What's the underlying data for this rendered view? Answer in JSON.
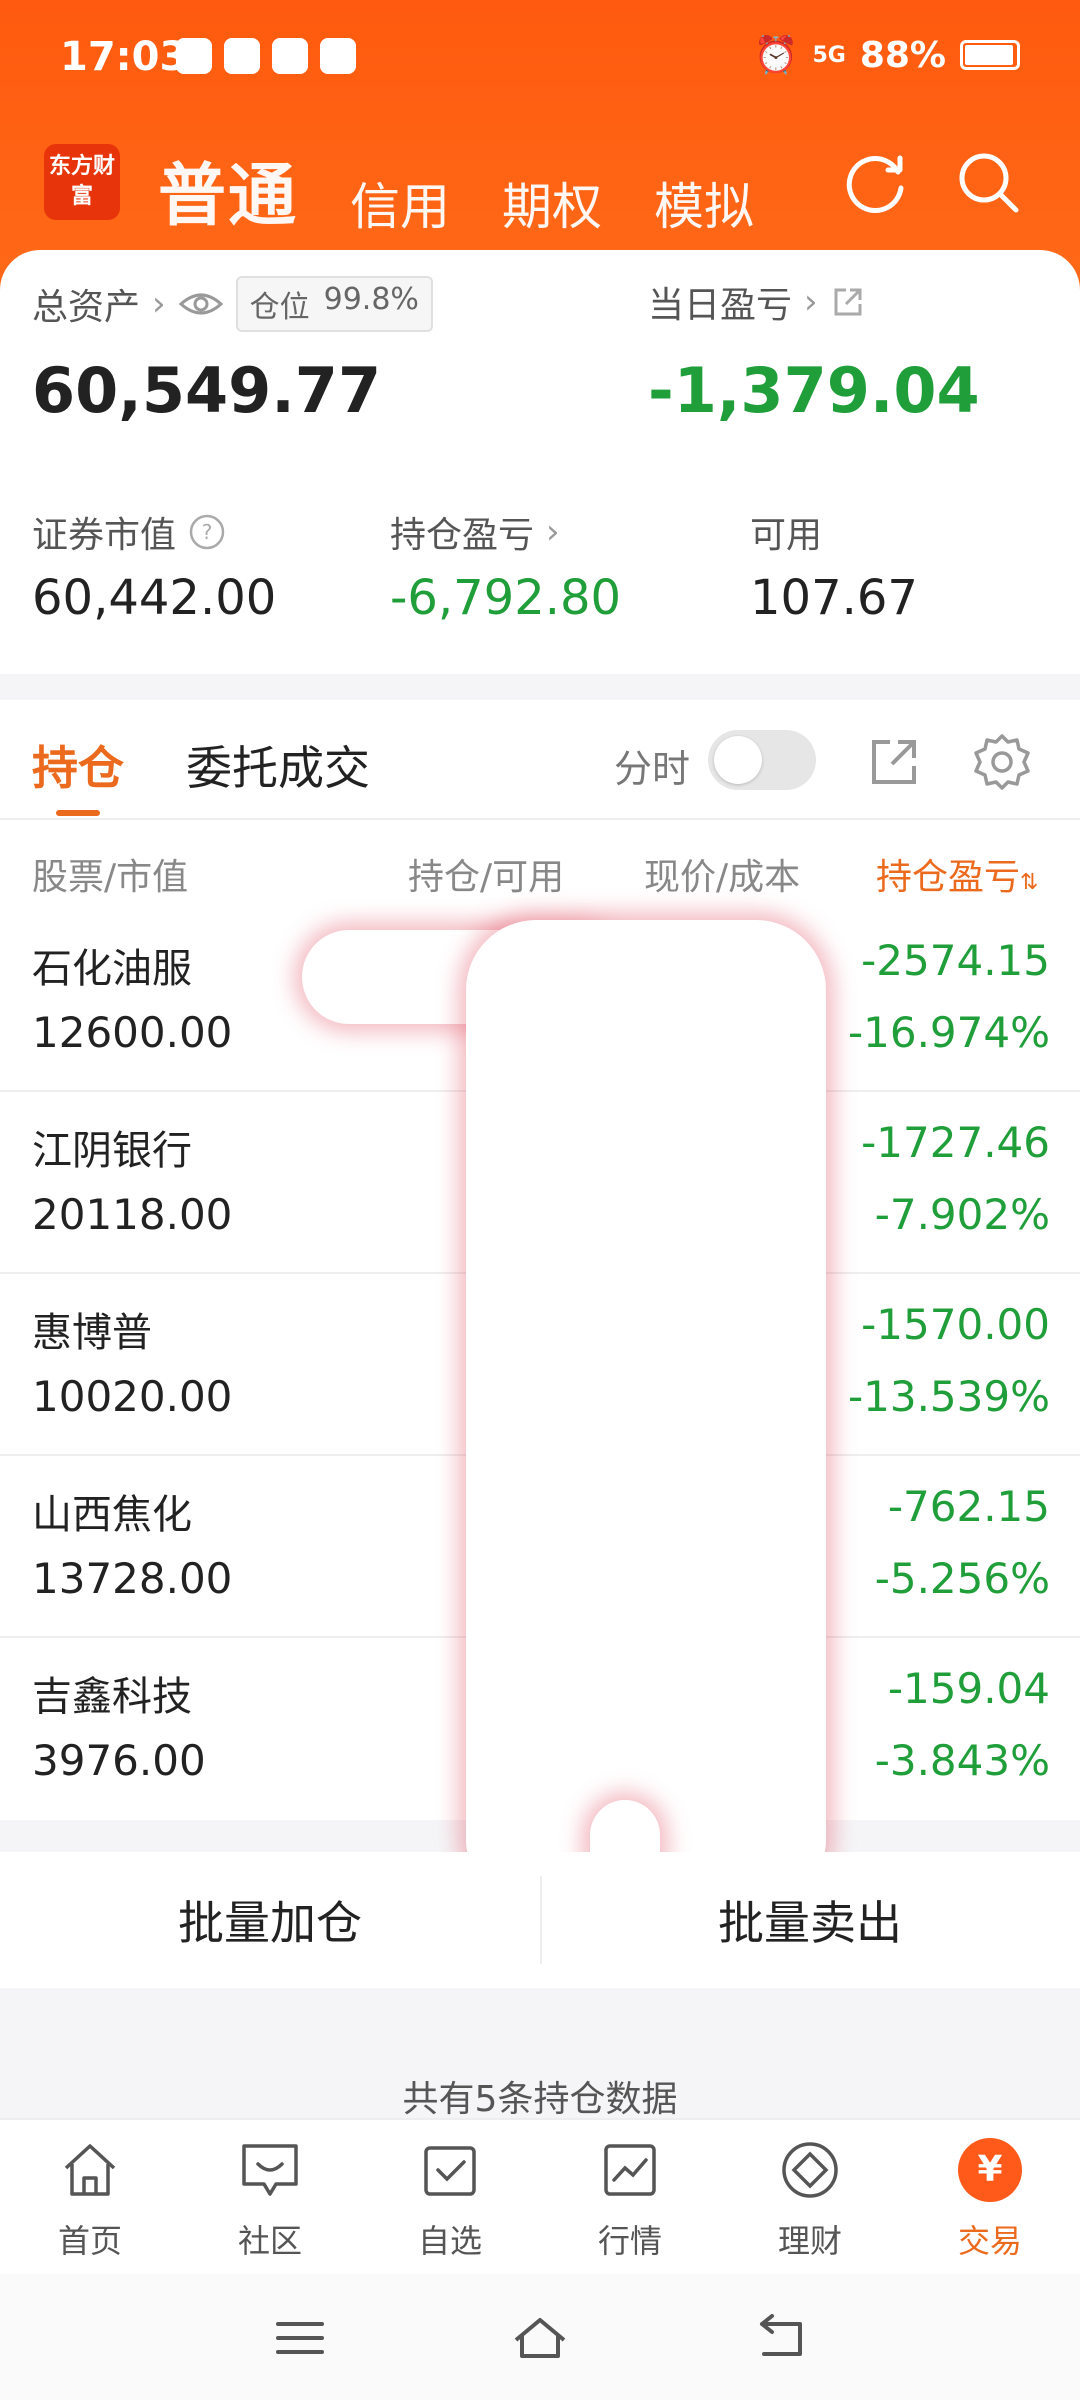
{
  "status_bar": {
    "time": "17:03",
    "battery": "88%",
    "signal": "5G"
  },
  "header": {
    "logo_text": "东方财富",
    "tabs": [
      "普通",
      "信用",
      "期权",
      "模拟"
    ]
  },
  "summary": {
    "total_assets_label": "总资产",
    "position_badge_label": "仓位",
    "position_badge_value": "99.8%",
    "total_assets_value": "60,549.77",
    "daily_pl_label": "当日盈亏",
    "daily_pl_value": "-1,379.04",
    "market_value_label": "证券市值",
    "market_value": "60,442.00",
    "holding_pl_label": "持仓盈亏",
    "holding_pl_value": "-6,792.80",
    "available_label": "可用",
    "available_value": "107.67"
  },
  "positions": {
    "tabs": [
      "持仓",
      "委托成交"
    ],
    "split_label": "分时",
    "columns": [
      "股票/市值",
      "持仓/可用",
      "现价/成本",
      "持仓盈亏"
    ],
    "rows": [
      {
        "name": "石化油服",
        "value": "12600.00",
        "pl": "-2574.15",
        "pct": "-16.974%"
      },
      {
        "name": "江阴银行",
        "value": "20118.00",
        "pl": "-1727.46",
        "pct": "-7.902%"
      },
      {
        "name": "惠博普",
        "value": "10020.00",
        "pl": "-1570.00",
        "pct": "-13.539%"
      },
      {
        "name": "山西焦化",
        "value": "13728.00",
        "pl": "-762.15",
        "pct": "-5.256%"
      },
      {
        "name": "吉鑫科技",
        "value": "3976.00",
        "pl": "-159.04",
        "pct": "-3.843%"
      }
    ]
  },
  "batch": {
    "add": "批量加仓",
    "sell": "批量卖出"
  },
  "summary_count": "共有5条持仓数据",
  "bottom_nav": [
    "首页",
    "社区",
    "自选",
    "行情",
    "理财",
    "交易"
  ],
  "colors": {
    "brand": "#ff5a0f",
    "accent": "#ec6a1e",
    "loss": "#1f9e3a"
  }
}
